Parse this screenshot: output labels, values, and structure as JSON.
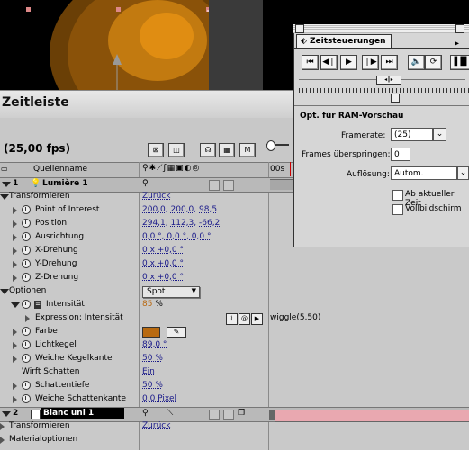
{
  "timeline": {
    "title": "Zeitleiste",
    "fps": "(25,00 fps)",
    "column_source": "Quellenname",
    "time_marker": "00s",
    "layers": [
      {
        "num": "1",
        "name": "Lumière 1"
      },
      {
        "num": "2",
        "name": "Blanc uni 1"
      }
    ],
    "rows": {
      "transform": "Transformieren",
      "reset": "Zurück",
      "poi": "Point of Interest",
      "poi_v1": "200,0",
      "poi_v2": "200,0",
      "poi_v3": "98,5",
      "pos": "Position",
      "pos_v1": "294,1",
      "pos_v2": "112,3",
      "pos_v3": "-66,2",
      "orient": "Ausrichtung",
      "orient_v": "0,0 °, 0,0 °, 0,0 °",
      "xrot": "X-Drehung",
      "yrot": "Y-Drehung",
      "zrot": "Z-Drehung",
      "rot_v": "0 x +0,0 °",
      "options": "Optionen",
      "light_type": "Spot",
      "intensity": "Intensität",
      "intensity_v": "85",
      "pct": "%",
      "expression": "Expression: Intensität",
      "expression_v": "wiggle(5,50)",
      "color": "Farbe",
      "cone": "Lichtkegel",
      "cone_v": "89,0 °",
      "feather": "Weiche Kegelkante",
      "feather_v": "50 %",
      "shadows": "Wirft Schatten",
      "shadows_v": "Ein",
      "shadow_depth": "Schattentiefe",
      "shadow_depth_v": "50 %",
      "shadow_soft": "Weiche Schattenkante",
      "shadow_soft_v": "0,0 Pixel",
      "transform2": "Transformieren",
      "reset2": "Zurück",
      "material": "Materialoptionen"
    },
    "colors": {
      "light_color": "#b86a10",
      "layer2_bar": "#e9a8b0"
    }
  },
  "panel": {
    "tab": "Zeitsteuerungen",
    "section": "Opt. für RAM-Vorschau",
    "framerate_label": "Framerate:",
    "framerate_value": "(25)",
    "skip_label": "Frames überspringen:",
    "skip_value": "0",
    "resolution_label": "Auflösung:",
    "resolution_value": "Autom.",
    "from_current": "Ab aktueller Zeit",
    "fullscreen": "Vollbildschirm"
  }
}
